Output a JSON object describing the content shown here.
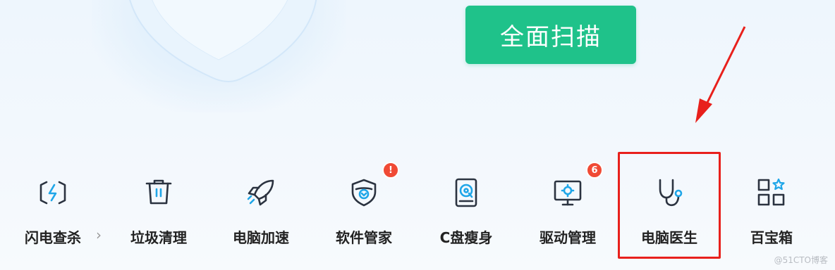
{
  "scan_button": {
    "label": "全面扫描"
  },
  "tools": [
    {
      "label": "闪电查杀",
      "icon": "lightning-icon"
    },
    {
      "label": "垃圾清理",
      "icon": "trash-icon"
    },
    {
      "label": "电脑加速",
      "icon": "rocket-icon"
    },
    {
      "label": "软件管家",
      "icon": "shield-app-icon",
      "badge": "!"
    },
    {
      "label": "C盘瘦身",
      "icon": "disk-icon"
    },
    {
      "label": "驱动管理",
      "icon": "monitor-gear-icon",
      "badge": "6"
    },
    {
      "label": "电脑医生",
      "icon": "stethoscope-icon"
    },
    {
      "label": "百宝箱",
      "icon": "toolbox-grid-icon"
    }
  ],
  "more_chevron": "›",
  "watermark": "@51CTO博客",
  "colors": {
    "accent": "#1fc28a",
    "badge": "#f04a35",
    "highlight": "#e8201c",
    "icon": "#2b3340"
  }
}
